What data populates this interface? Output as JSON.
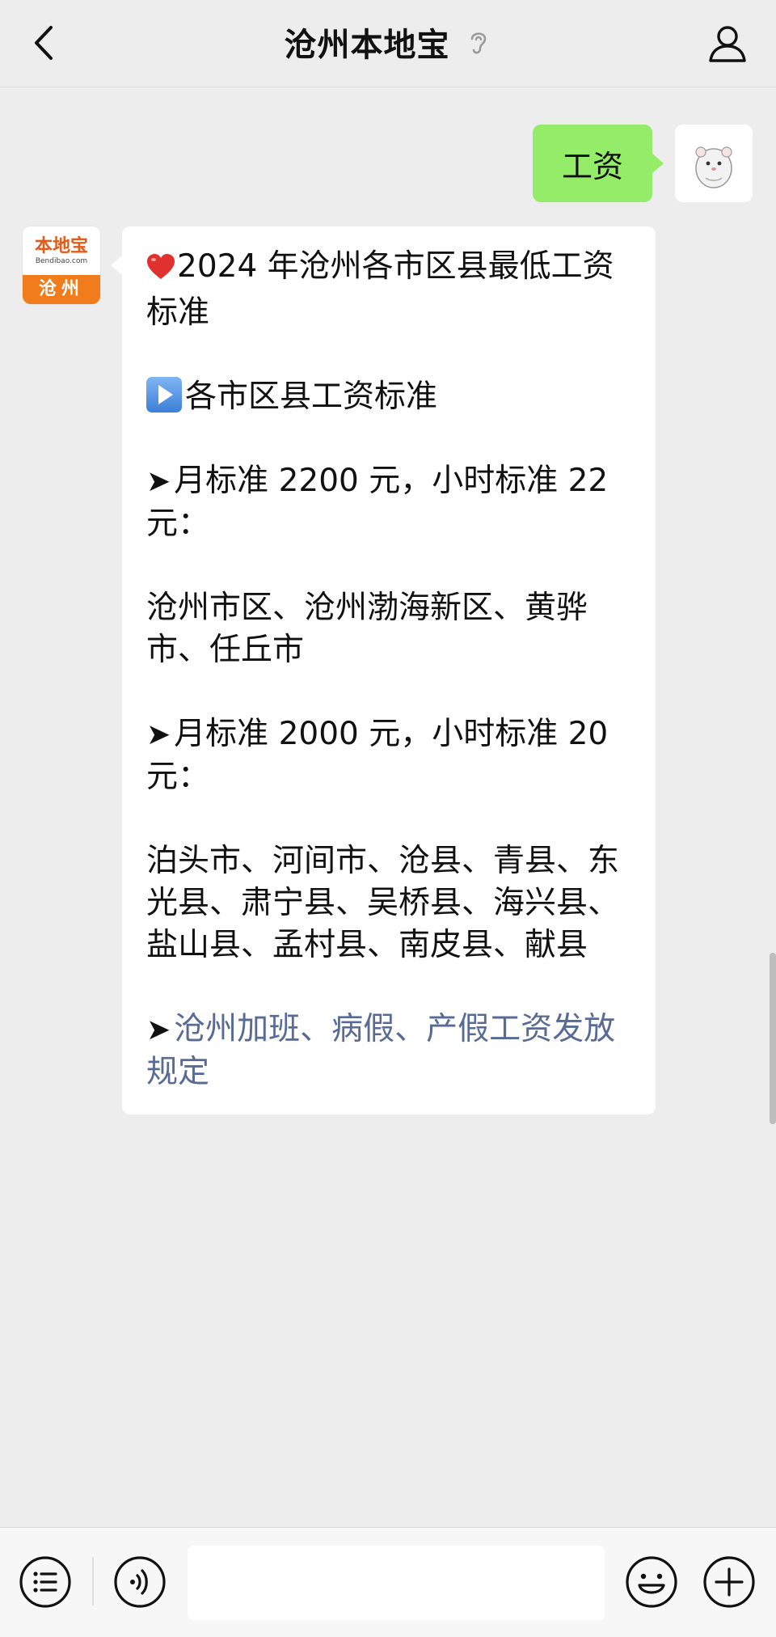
{
  "header": {
    "title": "沧州本地宝",
    "back_icon": "chevron-left-icon",
    "ear_icon": "ear-icon",
    "profile_icon": "person-icon"
  },
  "user_message": {
    "text": "工资"
  },
  "bot": {
    "avatar": {
      "logo_cn": "本地宝",
      "logo_en": "Bendibao.com",
      "city": "沧州"
    },
    "lines": {
      "title": "2024 年沧州各市区县最低工资标准",
      "section": "各市区县工资标准",
      "tier1_standard": "月标准 2200 元，小时标准 22 元：",
      "tier1_areas": "沧州市区、沧州渤海新区、黄骅市、任丘市",
      "tier2_standard": "月标准 2000 元，小时标准 20 元：",
      "tier2_areas": "泊头市、河间市、沧县、青县、东光县、肃宁县、吴桥县、海兴县、盐山县、孟村县、南皮县、献县",
      "link": "沧州加班、病假、产假工资发放规定"
    },
    "arrow_glyph": "➤"
  },
  "colors": {
    "background": "#ededed",
    "user_bubble": "#95ec69",
    "link": "#576b95",
    "brand_orange": "#f07c1c"
  },
  "bottom_bar": {
    "menu_icon": "list-menu-icon",
    "voice_icon": "voice-icon",
    "emoji_icon": "emoji-icon",
    "plus_icon": "plus-icon",
    "input_value": ""
  }
}
